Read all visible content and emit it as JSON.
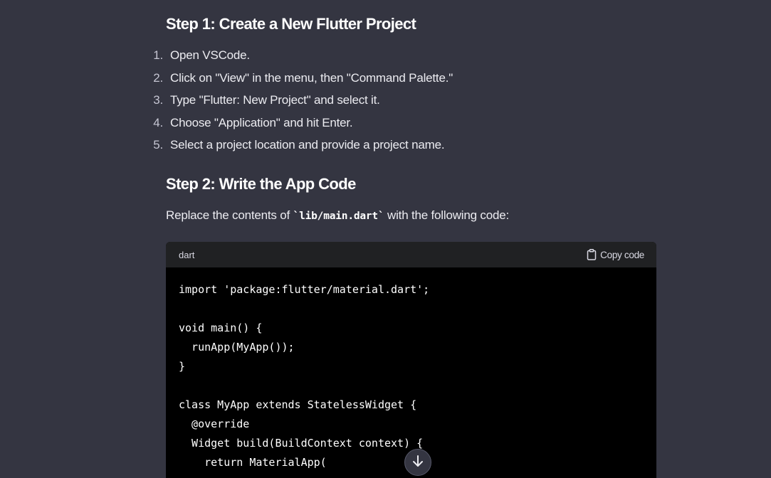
{
  "step1": {
    "heading": "Step 1: Create a New Flutter Project",
    "items": [
      {
        "num": "1.",
        "text": "Open VSCode."
      },
      {
        "num": "2.",
        "text": "Click on \"View\" in the menu, then \"Command Palette.\""
      },
      {
        "num": "3.",
        "text": "Type \"Flutter: New Project\" and select it."
      },
      {
        "num": "4.",
        "text": "Choose \"Application\" and hit Enter."
      },
      {
        "num": "5.",
        "text": "Select a project location and provide a project name."
      }
    ]
  },
  "step2": {
    "heading": "Step 2: Write the App Code",
    "intro_before": "Replace the contents of ",
    "intro_code": "`lib/main.dart`",
    "intro_after": " with the following code:"
  },
  "code_block": {
    "language": "dart",
    "copy_label": "Copy code",
    "copy_icon": "clipboard-icon",
    "lines": [
      "import 'package:flutter/material.dart';",
      "",
      "void main() {",
      "  runApp(MyApp());",
      "}",
      "",
      "class MyApp extends StatelessWidget {",
      "  @override",
      "  Widget build(BuildContext context) {",
      "    return MaterialApp("
    ]
  },
  "scroll_button": {
    "icon": "arrow-down-icon"
  },
  "colors": {
    "background": "#343541",
    "code_background": "#000000",
    "code_header": "#202123",
    "text": "#ececf1"
  }
}
